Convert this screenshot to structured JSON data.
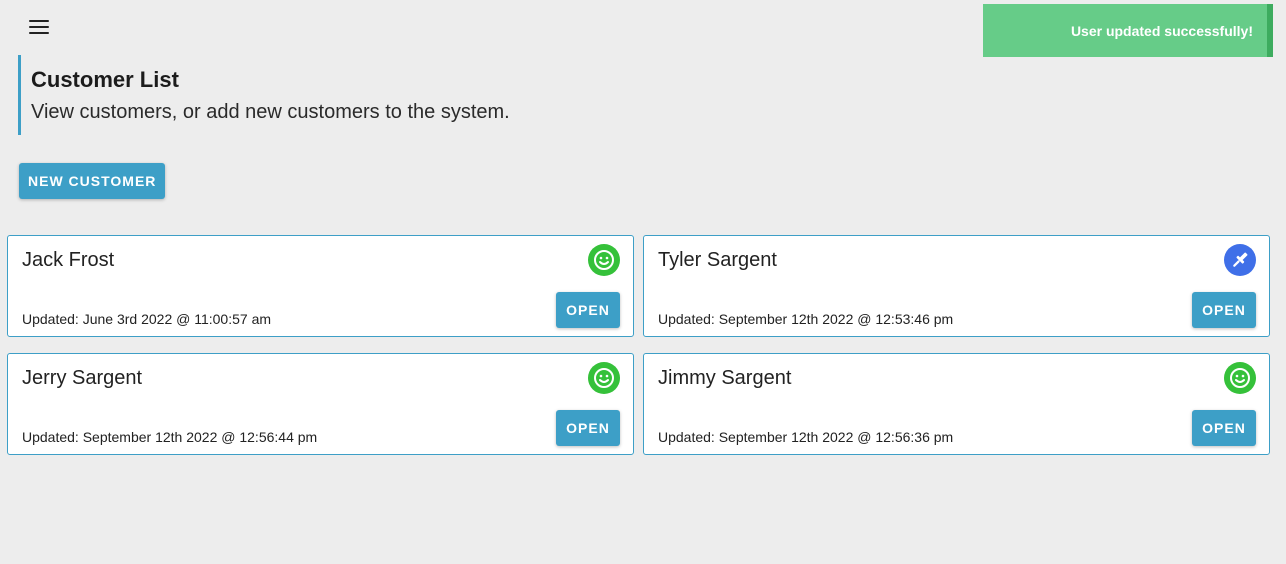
{
  "toast": {
    "message": "User updated successfully!",
    "color": "#66cc88"
  },
  "header": {
    "title": "Customer List",
    "subtitle": "View customers, or add new customers to the system."
  },
  "actions": {
    "new_customer_label": "NEW CUSTOMER"
  },
  "colors": {
    "accent": "#3d9fc7",
    "status_green": "#35c13a",
    "status_blue": "#3f6fe8",
    "background": "#ededed"
  },
  "customers": [
    {
      "name": "Jack Frost",
      "updated": "Updated: June 3rd 2022 @ 11:00:57 am",
      "status_icon": "smiley-icon",
      "open_label": "OPEN"
    },
    {
      "name": "Tyler Sargent",
      "updated": "Updated: September 12th 2022 @ 12:53:46 pm",
      "status_icon": "tool-icon",
      "open_label": "OPEN"
    },
    {
      "name": "Jerry Sargent",
      "updated": "Updated: September 12th 2022 @ 12:56:44 pm",
      "status_icon": "smiley-icon",
      "open_label": "OPEN"
    },
    {
      "name": "Jimmy Sargent",
      "updated": "Updated: September 12th 2022 @ 12:56:36 pm",
      "status_icon": "smiley-icon",
      "open_label": "OPEN"
    }
  ]
}
